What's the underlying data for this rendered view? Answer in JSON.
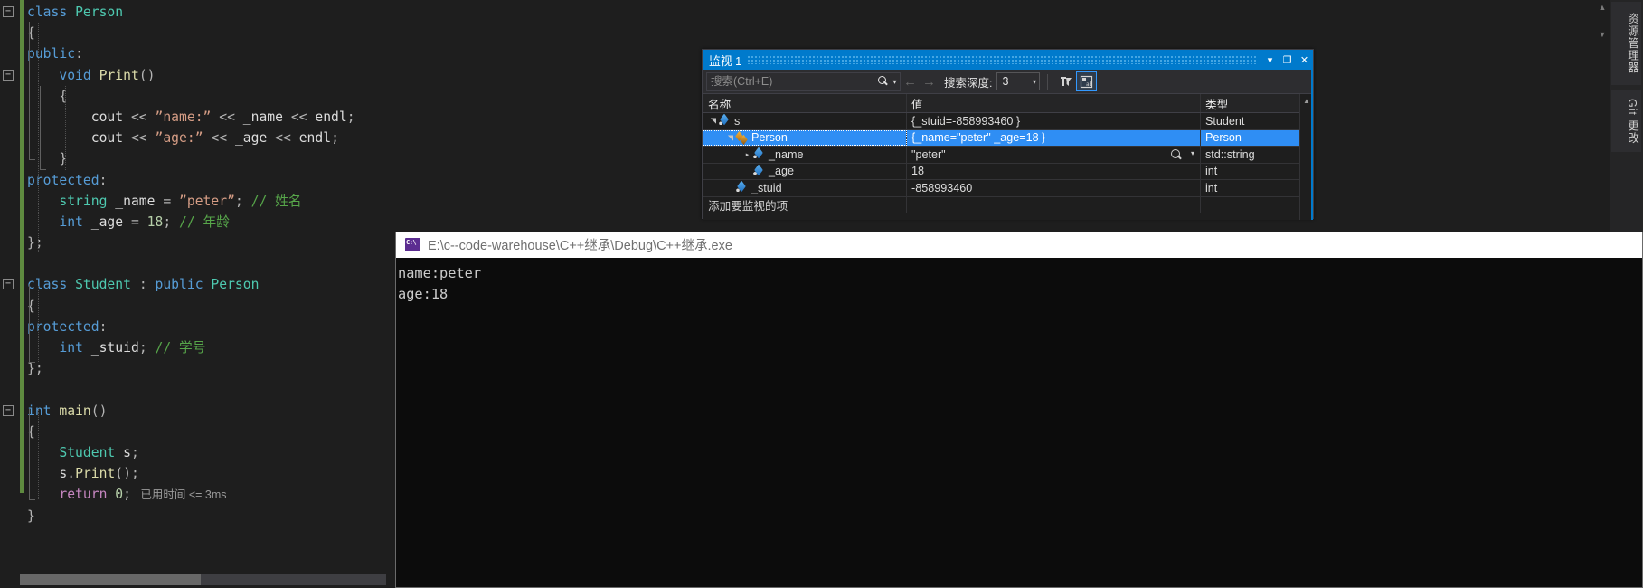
{
  "editor": {
    "lines": [
      {
        "indent": 0,
        "fold": "minus",
        "tokens": [
          {
            "t": "class ",
            "c": "k"
          },
          {
            "t": "Person",
            "c": "ty"
          }
        ]
      },
      {
        "indent": 0,
        "tokens": [
          {
            "t": "{",
            "c": "op"
          }
        ]
      },
      {
        "indent": 0,
        "tokens": [
          {
            "t": "public",
            "c": "k"
          },
          {
            "t": ":",
            "c": "op"
          }
        ]
      },
      {
        "indent": 1,
        "fold": "minus",
        "tokens": [
          {
            "t": "void ",
            "c": "k"
          },
          {
            "t": "Print",
            "c": "fn"
          },
          {
            "t": "()",
            "c": "op"
          }
        ]
      },
      {
        "indent": 1,
        "tokens": [
          {
            "t": "{",
            "c": "op"
          }
        ]
      },
      {
        "indent": 2,
        "tokens": [
          {
            "t": "cout ",
            "c": "id"
          },
          {
            "t": "<< ",
            "c": "op"
          },
          {
            "t": "”name:”",
            "c": "st"
          },
          {
            "t": " << ",
            "c": "op"
          },
          {
            "t": "_name",
            "c": "id"
          },
          {
            "t": " << ",
            "c": "op"
          },
          {
            "t": "endl",
            "c": "id"
          },
          {
            "t": ";",
            "c": "op"
          }
        ]
      },
      {
        "indent": 2,
        "tokens": [
          {
            "t": "cout ",
            "c": "id"
          },
          {
            "t": "<< ",
            "c": "op"
          },
          {
            "t": "”age:”",
            "c": "st"
          },
          {
            "t": " << ",
            "c": "op"
          },
          {
            "t": "_age",
            "c": "id"
          },
          {
            "t": " << ",
            "c": "op"
          },
          {
            "t": "endl",
            "c": "id"
          },
          {
            "t": ";",
            "c": "op"
          }
        ]
      },
      {
        "indent": 1,
        "tokens": [
          {
            "t": "}",
            "c": "op"
          }
        ]
      },
      {
        "indent": 0,
        "tokens": [
          {
            "t": "protected",
            "c": "k"
          },
          {
            "t": ":",
            "c": "op"
          }
        ]
      },
      {
        "indent": 1,
        "tokens": [
          {
            "t": "string ",
            "c": "ty"
          },
          {
            "t": "_name ",
            "c": "id"
          },
          {
            "t": "= ",
            "c": "op"
          },
          {
            "t": "”peter”",
            "c": "st"
          },
          {
            "t": "; ",
            "c": "op"
          },
          {
            "t": "// 姓名",
            "c": "cm"
          }
        ]
      },
      {
        "indent": 1,
        "tokens": [
          {
            "t": "int ",
            "c": "k"
          },
          {
            "t": "_age ",
            "c": "id"
          },
          {
            "t": "= ",
            "c": "op"
          },
          {
            "t": "18",
            "c": "nu"
          },
          {
            "t": "; ",
            "c": "op"
          },
          {
            "t": "// 年龄",
            "c": "cm"
          }
        ]
      },
      {
        "indent": 0,
        "tokens": [
          {
            "t": "};",
            "c": "op"
          }
        ]
      },
      {
        "indent": 0,
        "tokens": []
      },
      {
        "indent": 0,
        "fold": "minus",
        "tokens": [
          {
            "t": "class ",
            "c": "k"
          },
          {
            "t": "Student ",
            "c": "ty"
          },
          {
            "t": ": ",
            "c": "op"
          },
          {
            "t": "public ",
            "c": "k"
          },
          {
            "t": "Person",
            "c": "ty"
          }
        ]
      },
      {
        "indent": 0,
        "tokens": [
          {
            "t": "{",
            "c": "op"
          }
        ]
      },
      {
        "indent": 0,
        "tokens": [
          {
            "t": "protected",
            "c": "k"
          },
          {
            "t": ":",
            "c": "op"
          }
        ]
      },
      {
        "indent": 1,
        "tokens": [
          {
            "t": "int ",
            "c": "k"
          },
          {
            "t": "_stuid",
            "c": "id"
          },
          {
            "t": "; ",
            "c": "op"
          },
          {
            "t": "// 学号",
            "c": "cm"
          }
        ]
      },
      {
        "indent": 0,
        "tokens": [
          {
            "t": "};",
            "c": "op"
          }
        ]
      },
      {
        "indent": 0,
        "tokens": []
      },
      {
        "indent": 0,
        "fold": "minus",
        "tokens": [
          {
            "t": "int ",
            "c": "k"
          },
          {
            "t": "main",
            "c": "fn"
          },
          {
            "t": "()",
            "c": "op"
          }
        ]
      },
      {
        "indent": 0,
        "tokens": [
          {
            "t": "{",
            "c": "op"
          }
        ]
      },
      {
        "indent": 1,
        "tokens": [
          {
            "t": "Student ",
            "c": "ty"
          },
          {
            "t": "s",
            "c": "id"
          },
          {
            "t": ";",
            "c": "op"
          }
        ]
      },
      {
        "indent": 1,
        "tokens": [
          {
            "t": "s",
            "c": "id"
          },
          {
            "t": ".",
            "c": "op"
          },
          {
            "t": "Print",
            "c": "fn"
          },
          {
            "t": "()",
            "c": "op"
          },
          {
            "t": ";",
            "c": "op"
          }
        ]
      },
      {
        "indent": 1,
        "tokens": [
          {
            "t": "return ",
            "c": "pn"
          },
          {
            "t": "0",
            "c": "nu"
          },
          {
            "t": ";",
            "c": "op"
          }
        ],
        "elapsed": "已用时间 <= 3ms"
      },
      {
        "indent": 0,
        "tokens": [
          {
            "t": "}",
            "c": "op"
          }
        ]
      }
    ],
    "elapsed_text": "已用时间 <= 3ms"
  },
  "watch": {
    "title": "监视 1",
    "buttons": {
      "dropdown": "▾",
      "maximize": "❐",
      "close": "✕"
    },
    "toolbar": {
      "search_placeholder": "搜索(Ctrl+E)",
      "search_value": "",
      "search_icon": "magnifier-icon",
      "dropdown_caret": "▾",
      "back_arrow": "←",
      "forward_arrow": "→",
      "depth_label": "搜索深度:",
      "depth_value": "3",
      "depth_caret": "▾",
      "pin_icon": "pin-filter-icon",
      "hex_icon": "hex-display-icon"
    },
    "columns": [
      "名称",
      "值",
      "类型"
    ],
    "rows": [
      {
        "indent": 0,
        "expander": "open",
        "icon": "field-cube-icon",
        "name": "s",
        "value": "{_stuid=-858993460 }",
        "type": "Student",
        "selected": false,
        "magnifier": false
      },
      {
        "indent": 1,
        "expander": "open",
        "icon": "base-class-icon",
        "name": "Person",
        "value": "{_name=\"peter\" _age=18 }",
        "type": "Person",
        "selected": true,
        "magnifier": false
      },
      {
        "indent": 2,
        "expander": "closed",
        "icon": "field-cube-icon",
        "name": "_name",
        "value": "\"peter\"",
        "type": "std::string",
        "selected": false,
        "magnifier": true
      },
      {
        "indent": 2,
        "expander": "none",
        "icon": "field-cube-icon",
        "name": "_age",
        "value": "18",
        "type": "int",
        "selected": false,
        "magnifier": false
      },
      {
        "indent": 1,
        "expander": "none",
        "icon": "field-cube-icon",
        "name": "_stuid",
        "value": "-858993460",
        "type": "int",
        "selected": false,
        "magnifier": false
      }
    ],
    "add_row_placeholder": "添加要监视的项",
    "scroll_up_arrow": "▲",
    "accent_color": "#007acc",
    "selection_color": "#2f8ef4"
  },
  "console": {
    "icon": "cmd-prompt-icon",
    "path": "E:\\c--code-warehouse\\C++继承\\Debug\\C++继承.exe",
    "output": "name:peter\nage:18"
  },
  "dock_tabs": [
    {
      "label": "资源管理器",
      "name": "solution-explorer-tab"
    },
    {
      "label": "Git 更改",
      "name": "git-changes-tab"
    }
  ],
  "vs_scroll": {
    "up": "▲",
    "down": "▼"
  }
}
